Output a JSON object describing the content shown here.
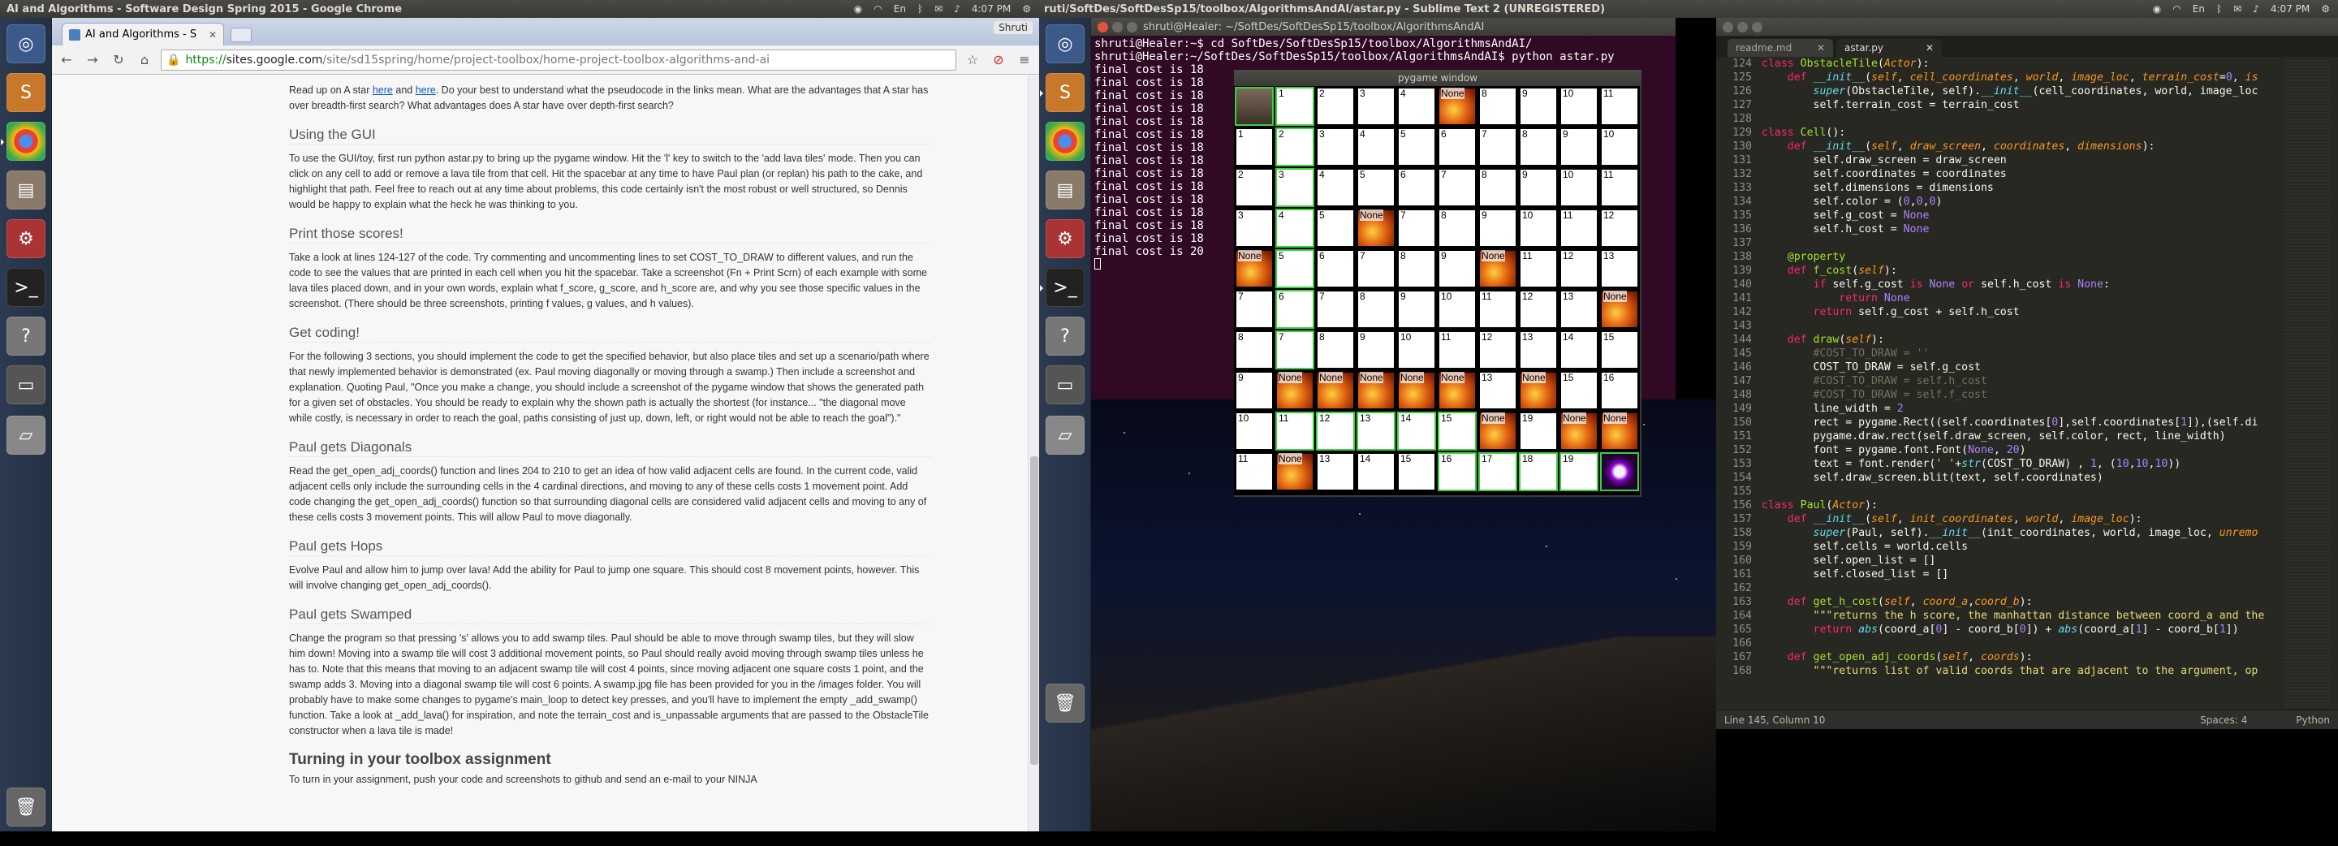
{
  "left_topbar": {
    "title": "AI and Algorithms - Software Design Spring 2015 - Google Chrome",
    "time": "4:07 PM",
    "kb": "En"
  },
  "right_topbar": {
    "title": "ruti/SoftDes/SoftDesSp15/toolbox/AlgorithmsAndAI/astar.py - Sublime Text 2 (UNREGISTERED)",
    "time": "4:07 PM",
    "kb": "En"
  },
  "chrome": {
    "tab_title": "AI and Algorithms - S",
    "user": "Shruti",
    "url_scheme": "https://",
    "url_host": "sites.google.com",
    "url_path": "/site/sd15spring/home/project-toolbox/home-project-toolbox-algorithms-and-ai"
  },
  "article": {
    "intro_a": "Read up on A star ",
    "intro_link1": "here",
    "intro_and": " and ",
    "intro_link2": "here",
    "intro_b": ". Do your best to understand what the pseudocode in the links mean. What are the advantages that A star has over breadth-first search? What advantages does A star have over depth-first search?",
    "h_gui": "Using the GUI",
    "p_gui": "To use the GUI/toy, first run python astar.py to bring up the pygame window. Hit the 'l' key to switch to the 'add lava tiles' mode. Then you can click on any cell to add or remove a lava tile from that cell. Hit the spacebar at any time to have Paul plan (or replan) his path to the cake, and highlight that path. Feel free to reach out at any time about problems, this code certainly isn't the most robust or well structured, so Dennis would be happy to explain what the heck he was thinking to you.",
    "h_print": "Print those scores!",
    "p_print": "Take a look at lines 124-127 of the code. Try commenting and uncommenting lines to set COST_TO_DRAW to different values, and run the code to see the values that are printed in each cell when you hit the spacebar. Take a screenshot (Fn + Print Scrn) of each example with some lava tiles placed down, and in your own words, explain what f_score, g_score, and h_score are, and why you see those specific values in the screenshot. (There should be three screenshots, printing f values, g values, and h values).",
    "h_coding": "Get coding!",
    "p_coding": "For the following 3 sections, you should implement the code to get the specified behavior, but also place tiles and set up a scenario/path where that newly implemented behavior is demonstrated (ex. Paul moving diagonally or moving through a swamp.) Then include a screenshot and explanation. Quoting Paul, \"Once you make a change, you should include a screenshot of the pygame window that shows the generated path for a given set of obstacles. You should be ready to explain why the shown path is actually the shortest (for instance... \"the diagonal move while costly, is necessary in order to reach the goal, paths consisting of just up, down, left, or right would not be able to reach the goal\").\"",
    "h_diag": "Paul gets Diagonals",
    "p_diag": "Read the get_open_adj_coords() function and lines 204 to 210 to get an idea of how valid adjacent cells are found. In the current code, valid adjacent cells only include the surrounding cells in the 4 cardinal directions, and moving to any of these cells costs 1 movement point. Add code changing the get_open_adj_coords() function so that surrounding diagonal cells are considered valid adjacent cells and moving to any of these cells costs 3 movement points. This will allow Paul to move diagonally.",
    "h_hops": "Paul gets Hops",
    "p_hops": "Evolve Paul and allow him to jump over lava! Add the ability for Paul to jump one square. This should cost 8 movement points, however. This will involve changing get_open_adj_coords().",
    "h_swamp": "Paul gets Swamped",
    "p_swamp": "Change the program so that pressing 's' allows you to add swamp tiles. Paul should be able to move through swamp tiles, but they will slow him down! Moving into a swamp tile will cost 3 additional movement points, so Paul should really avoid moving through swamp tiles unless he has to. Note that this means that moving to an adjacent swamp tile will cost 4 points, since moving adjacent one square costs 1 point, and the swamp adds 3. Moving into a diagonal swamp tile will cost 6 points. A swamp.jpg file has been provided for you in the /images folder. You will probably have to make some changes to pygame's main_loop to detect key presses, and you'll have to implement the empty _add_swamp() function. Take a look at _add_lava() for inspiration, and note the terrain_cost and is_unpassable arguments that are passed to the ObstacleTile constructor when a lava tile is made!",
    "h_toolbox": "Turning in your toolbox assignment",
    "p_toolbox": "To turn in your assignment, push your code and screenshots to github and send an e-mail to your NINJA"
  },
  "terminal": {
    "title": "shruti@Healer: ~/SoftDes/SoftDesSp15/toolbox/AlgorithmsAndAI",
    "lines": [
      "shruti@Healer:~$ cd SoftDes/SoftDesSp15/toolbox/AlgorithmsAndAI/",
      "shruti@Healer:~/SoftDes/SoftDesSp15/toolbox/AlgorithmsAndAI$ python astar.py",
      "final cost is 18",
      "final cost is 18",
      "final cost is 18",
      "final cost is 18",
      "final cost is 18",
      "final cost is 18",
      "final cost is 18",
      "final cost is 18",
      "final cost is 18",
      "final cost is 18",
      "final cost is 18",
      "final cost is 18",
      "final cost is 18",
      "final cost is 18",
      "final cost is 20"
    ]
  },
  "pygame": {
    "title": "pygame window",
    "rows": [
      [
        {
          "t": "",
          "k": "paul",
          "g": 1
        },
        {
          "t": "1",
          "g": 1
        },
        {
          "t": "2"
        },
        {
          "t": "3"
        },
        {
          "t": "4"
        },
        {
          "t": "None",
          "k": "lava"
        },
        {
          "t": "8"
        },
        {
          "t": "9"
        },
        {
          "t": "10"
        },
        {
          "t": "11"
        }
      ],
      [
        {
          "t": "1"
        },
        {
          "t": "2",
          "g": 1
        },
        {
          "t": "3"
        },
        {
          "t": "4"
        },
        {
          "t": "5"
        },
        {
          "t": "6"
        },
        {
          "t": "7"
        },
        {
          "t": "8"
        },
        {
          "t": "9"
        },
        {
          "t": "10"
        }
      ],
      [
        {
          "t": "2"
        },
        {
          "t": "3",
          "g": 1
        },
        {
          "t": "4"
        },
        {
          "t": "5"
        },
        {
          "t": "6"
        },
        {
          "t": "7"
        },
        {
          "t": "8"
        },
        {
          "t": "9"
        },
        {
          "t": "10"
        },
        {
          "t": "11"
        }
      ],
      [
        {
          "t": "3"
        },
        {
          "t": "4",
          "g": 1
        },
        {
          "t": "5"
        },
        {
          "t": "None",
          "k": "lava"
        },
        {
          "t": "7"
        },
        {
          "t": "8"
        },
        {
          "t": "9"
        },
        {
          "t": "10"
        },
        {
          "t": "11"
        },
        {
          "t": "12"
        }
      ],
      [
        {
          "t": "None",
          "k": "lava"
        },
        {
          "t": "5",
          "g": 1
        },
        {
          "t": "6"
        },
        {
          "t": "7"
        },
        {
          "t": "8"
        },
        {
          "t": "9"
        },
        {
          "t": "None",
          "k": "lava"
        },
        {
          "t": "11"
        },
        {
          "t": "12"
        },
        {
          "t": "13"
        }
      ],
      [
        {
          "t": "7"
        },
        {
          "t": "6",
          "g": 1
        },
        {
          "t": "7"
        },
        {
          "t": "8"
        },
        {
          "t": "9"
        },
        {
          "t": "10"
        },
        {
          "t": "11"
        },
        {
          "t": "12"
        },
        {
          "t": "13"
        },
        {
          "t": "None",
          "k": "lava"
        }
      ],
      [
        {
          "t": "8"
        },
        {
          "t": "7",
          "g": 1
        },
        {
          "t": "8"
        },
        {
          "t": "9"
        },
        {
          "t": "10"
        },
        {
          "t": "11"
        },
        {
          "t": "12"
        },
        {
          "t": "13"
        },
        {
          "t": "14"
        },
        {
          "t": "15"
        }
      ],
      [
        {
          "t": "9"
        },
        {
          "t": "None",
          "k": "lava"
        },
        {
          "t": "None",
          "k": "lava"
        },
        {
          "t": "None",
          "k": "lava"
        },
        {
          "t": "None",
          "k": "lava"
        },
        {
          "t": "None",
          "k": "lava"
        },
        {
          "t": "13"
        },
        {
          "t": "None",
          "k": "lava"
        },
        {
          "t": "15"
        },
        {
          "t": "16"
        }
      ],
      [
        {
          "t": "10"
        },
        {
          "t": "11",
          "g": 1
        },
        {
          "t": "12",
          "g": 1
        },
        {
          "t": "13",
          "g": 1
        },
        {
          "t": "14",
          "g": 1
        },
        {
          "t": "15",
          "g": 1
        },
        {
          "t": "None",
          "k": "lava"
        },
        {
          "t": "19"
        },
        {
          "t": "None",
          "k": "lava"
        },
        {
          "t": "None",
          "k": "lava"
        }
      ]
    ],
    "last_row": [
      {
        "t": "11"
      },
      {
        "t": "None",
        "k": "lava"
      },
      {
        "t": "13"
      },
      {
        "t": "14"
      },
      {
        "t": "15"
      },
      {
        "t": "16",
        "g": 1
      },
      {
        "t": "17",
        "g": 1
      },
      {
        "t": "18",
        "g": 1
      },
      {
        "t": "19",
        "g": 1
      },
      {
        "t": "",
        "k": "cake",
        "g": 1
      }
    ]
  },
  "sublime": {
    "tabs": [
      {
        "label": "readme.md"
      },
      {
        "label": "astar.py"
      }
    ],
    "status_left": "Line 145, Column 10",
    "status_spaces": "Spaces: 4",
    "status_lang": "Python"
  }
}
